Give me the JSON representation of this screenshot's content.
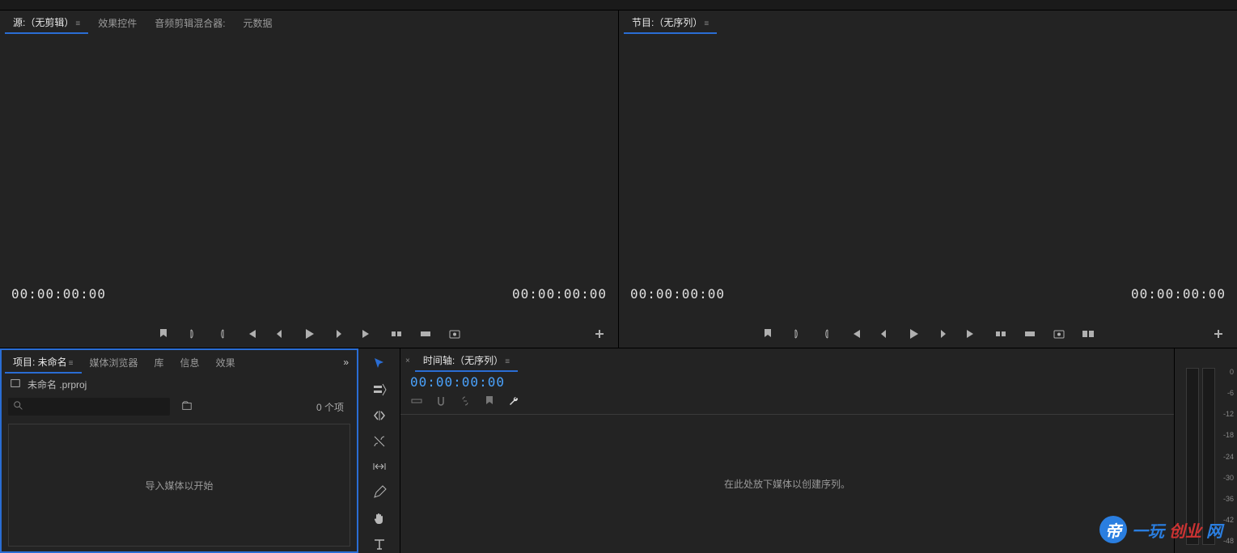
{
  "source": {
    "tabs": [
      "源:（无剪辑）",
      "效果控件",
      "音频剪辑混合器:",
      "元数据"
    ],
    "time_left": "00:00:00:00",
    "time_right": "00:00:00:00"
  },
  "program": {
    "title": "节目:（无序列）",
    "time_left": "00:00:00:00",
    "time_right": "00:00:00:00"
  },
  "project": {
    "tabs": [
      "项目: 未命名",
      "媒体浏览器",
      "库",
      "信息",
      "效果"
    ],
    "file_name": "未命名 .prproj",
    "search_placeholder": "",
    "item_count": "0 个项",
    "empty_hint": "导入媒体以开始"
  },
  "timeline": {
    "title": "时间轴:（无序列）",
    "time": "00:00:00:00",
    "empty_hint": "在此处放下媒体以创建序列。"
  },
  "meter": {
    "labels": [
      "0",
      "-6",
      "-12",
      "-18",
      "-24",
      "-30",
      "-36",
      "-42",
      "-48"
    ]
  },
  "watermark": {
    "badge": "帝",
    "t1": "一玩",
    "t2": "创业",
    "t3": "网"
  },
  "icons": {
    "selection": "selection-tool",
    "track_select": "track-select-tool",
    "ripple": "ripple-edit-tool",
    "razor": "razor-tool",
    "slip": "slip-tool",
    "pen": "pen-tool",
    "hand": "hand-tool",
    "type": "type-tool"
  }
}
